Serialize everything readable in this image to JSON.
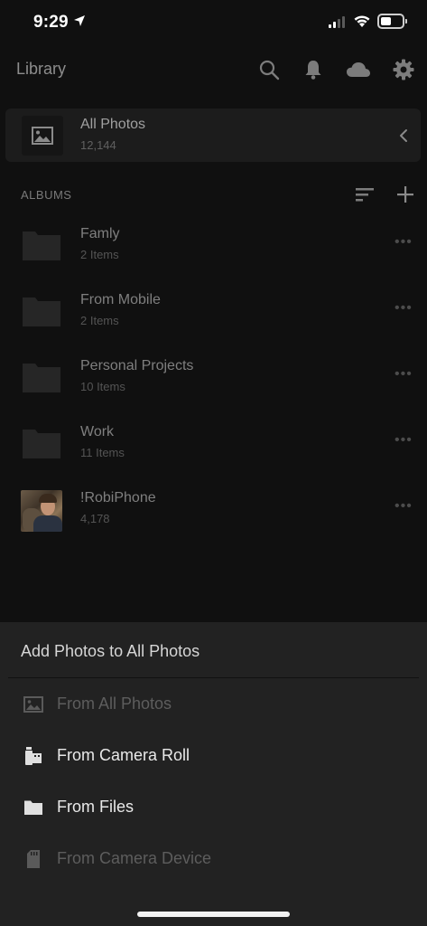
{
  "status_bar": {
    "time": "9:29"
  },
  "header": {
    "title": "Library"
  },
  "all_photos": {
    "title": "All Photos",
    "count": "12,144"
  },
  "albums_section": {
    "label": "ALBUMS"
  },
  "albums": [
    {
      "name": "Famly",
      "sub": "2 Items",
      "thumb": "folder"
    },
    {
      "name": "From Mobile",
      "sub": "2 Items",
      "thumb": "folder"
    },
    {
      "name": "Personal Projects",
      "sub": "10 Items",
      "thumb": "folder"
    },
    {
      "name": "Work",
      "sub": "11 Items",
      "thumb": "folder"
    },
    {
      "name": "!RobiPhone",
      "sub": "4,178",
      "thumb": "photo"
    }
  ],
  "sheet": {
    "title": "Add Photos to All Photos",
    "items": [
      {
        "label": "From All Photos",
        "icon": "image-icon",
        "enabled": false
      },
      {
        "label": "From Camera Roll",
        "icon": "camera-roll-icon",
        "enabled": true
      },
      {
        "label": "From Files",
        "icon": "folder-icon",
        "enabled": true
      },
      {
        "label": "From Camera Device",
        "icon": "sd-card-icon",
        "enabled": false
      }
    ]
  },
  "colors": {
    "background": "#101010",
    "sheet": "#222222",
    "text_enabled": "#e9e9e9",
    "text_disabled": "#5d5d5d"
  }
}
